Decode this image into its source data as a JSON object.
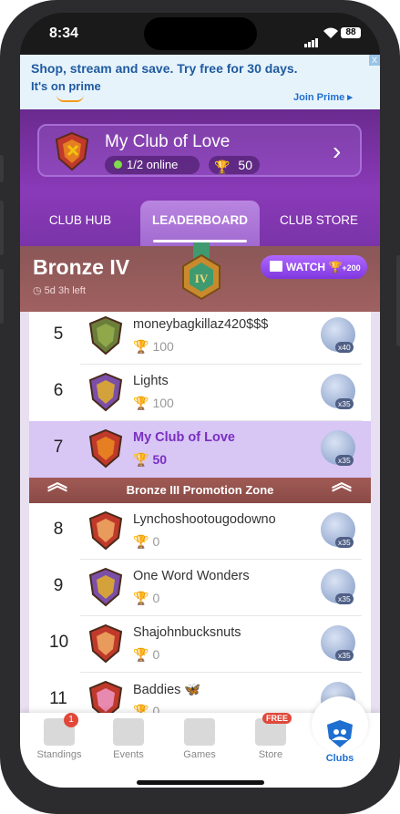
{
  "status_bar": {
    "time": "8:34",
    "battery": "88"
  },
  "ad": {
    "line1": "Shop, stream and save. Try free for 30 days.",
    "line2": "It's on prime",
    "cta": "Join Prime ▸",
    "close": "X"
  },
  "club": {
    "name": "My Club of Love",
    "online": "1/2 online",
    "points": "50",
    "chevron": "›"
  },
  "tabs": [
    "CLUB HUB",
    "LEADERBOARD",
    "CLUB STORE"
  ],
  "league": {
    "title": "Bronze IV",
    "time_left": "5d 3h left",
    "medal": "IV",
    "watch_label": "WATCH",
    "watch_bonus": "+200"
  },
  "leaderboard": [
    {
      "rank": "5",
      "name": "moneybagkillaz420$$$",
      "points": "100",
      "mult": "x40"
    },
    {
      "rank": "6",
      "name": "Lights",
      "points": "100",
      "mult": "x35"
    },
    {
      "rank": "7",
      "name": "My Club of Love",
      "points": "50",
      "mult": "x35"
    },
    {
      "rank": "8",
      "name": "Lynchoshootougodowno",
      "points": "0",
      "mult": "x35"
    },
    {
      "rank": "9",
      "name": "One Word Wonders",
      "points": "0",
      "mult": "x35"
    },
    {
      "rank": "10",
      "name": "Shajohnbucksnuts",
      "points": "0",
      "mult": "x35"
    },
    {
      "rank": "11",
      "name": "Baddies 🦋",
      "points": "0",
      "mult": ""
    }
  ],
  "promo_zone": "Bronze III Promotion Zone",
  "nav": {
    "standings": "Standings",
    "standings_badge": "1",
    "events": "Events",
    "games": "Games",
    "store": "Store",
    "store_badge": "FREE",
    "clubs": "Clubs"
  },
  "colors": {
    "accent": "#1f6fd0",
    "club_purple": "#8a3ab8",
    "bronze": "#a06060",
    "highlight_row": "#d8c6f5"
  }
}
